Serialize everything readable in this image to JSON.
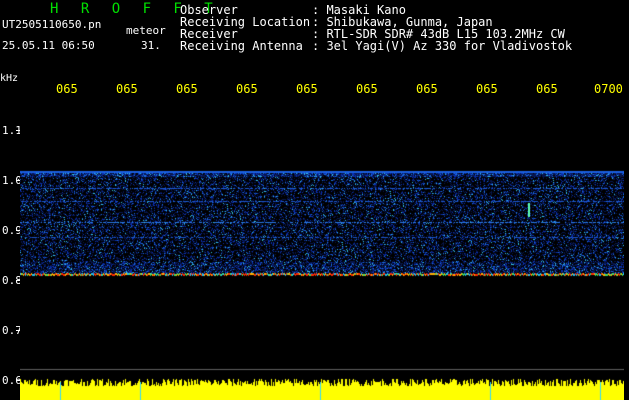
{
  "app": {
    "name": "H R O F F T",
    "filename": "UT2505110650.pn",
    "file_type_label": "meteor",
    "datetime": "25.05.11 06:50",
    "seconds_label": "31."
  },
  "station_info": [
    {
      "label": "Observer",
      "value": ": Masaki Kano"
    },
    {
      "label": "Receiving Location",
      "value": ": Shibukawa, Gunma, Japan"
    },
    {
      "label": "Receiver",
      "value": ": RTL-SDR SDR# 43dB L15 103.2MHz CW"
    },
    {
      "label": "Receiving Antenna",
      "value": ": 3el Yagi(V) Az 330 for Vladivostok"
    }
  ],
  "y_axis": {
    "unit": "kHz",
    "ticks": [
      "1.1",
      "1.0",
      "0.9",
      "0.8",
      "0.7",
      "0.6"
    ]
  },
  "time_axis": {
    "labels": [
      "065",
      "065",
      "065",
      "065",
      "065",
      "065",
      "065",
      "065",
      "065",
      "0700"
    ]
  },
  "colors": {
    "background": "#000000",
    "header_text": "#ffffff",
    "title": "#00e000",
    "time_labels": "#ffff00",
    "noise_band": "#0a2a9a",
    "echo_line": "#ff3000",
    "signal_bar": "#ffff00"
  }
}
